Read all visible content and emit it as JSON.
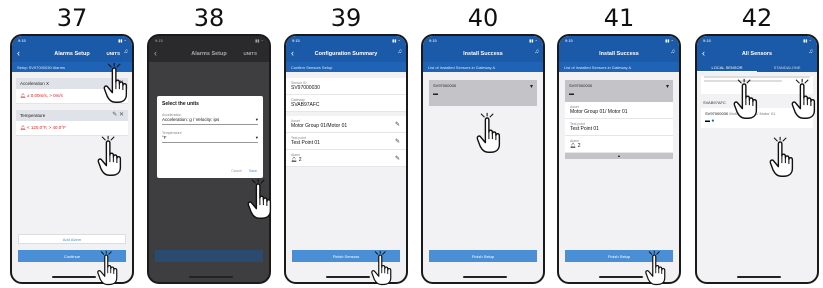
{
  "steps": [
    "37",
    "38",
    "39",
    "40",
    "41",
    "42"
  ],
  "status_time": "9:15",
  "screen37": {
    "title": "Alarms Setup",
    "units": "UNITS",
    "subhead": "Setup SV97000030 Alarms",
    "accel_label": "Acceleration X",
    "accel_value": "± 0.00m/s, > 0m/s",
    "temp_label": "Temperature",
    "temp_value": "< 120.0°F, > 40.0°F",
    "add_button": "Add Alarm",
    "continue_button": "Continue"
  },
  "screen38": {
    "title": "Alarms Setup",
    "units": "UNITS",
    "dialog_title": "Select the units",
    "accel_field_label": "Acceleration",
    "accel_option": "Acceleration: g / Velocity: ips",
    "temp_field_label": "Temperature",
    "temp_option": "°F",
    "cancel": "Cancel",
    "save": "Save"
  },
  "screen39": {
    "title": "Configuration Summary",
    "subhead": "Confirm Sensors Setup",
    "sensor_id_label": "Sensor ID",
    "sensor_id": "SV97000030",
    "gateway_label": "Gateway",
    "gateway": "SVAB97AFC",
    "asset_label": "Asset",
    "asset": "Motor Group 01/Motor 01",
    "point_label": "Test point",
    "point": "Test Point 01",
    "alarm_label": "Alarm",
    "alarm": "2",
    "button": "Finish Sensors"
  },
  "screen40": {
    "title": "Install Success",
    "subhead": "List of Installed Sensors in Gateway A",
    "sensor_id": "SV97000030",
    "button": "Finish Setup"
  },
  "screen41": {
    "title": "Install Success",
    "subhead": "List of Installed Sensors in Gateway A",
    "sensor_id": "SV97000030",
    "asset_label": "Asset",
    "asset": "Motor Group 01/ Motor 01",
    "point_label": "Test point",
    "point": "Test Point 01",
    "alarm_label": "Alarm",
    "alarm": "2",
    "button": "Finish Setup"
  },
  "screen42": {
    "title": "All Sensors",
    "tab_local": "LOCAL SENSOR",
    "tab_standalone": "STANDALONE",
    "gateway": "SVAB97AFC",
    "sensor_id": "SV97000030",
    "sensor_asset": "Motor Group 01/ Motor 01"
  }
}
